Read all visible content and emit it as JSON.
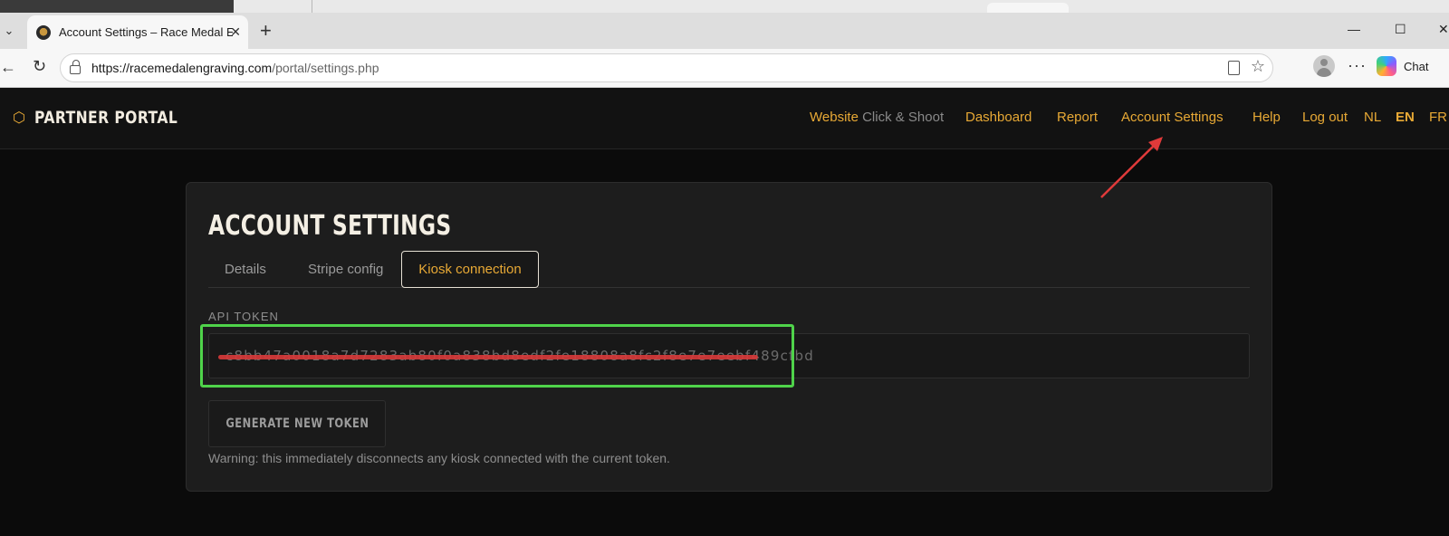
{
  "browser": {
    "tab_title": "Account Settings – Race Medal Engraving",
    "close_glyph": "✕",
    "newtab_glyph": "+",
    "url_host": "https://racemedalengraving.com",
    "url_path": "/portal/settings.php",
    "chat_label": "Chat",
    "win_min": "—",
    "win_max": "☐",
    "win_close": "✕"
  },
  "header": {
    "brand": "PARTNER PORTAL",
    "nav": {
      "website": "Website",
      "website_sub": "Click & Shoot",
      "dashboard": "Dashboard",
      "report": "Report",
      "account_settings": "Account Settings",
      "help": "Help",
      "logout": "Log out",
      "lang_nl": "NL",
      "lang_en": "EN",
      "lang_fr": "FR"
    }
  },
  "card": {
    "title": "ACCOUNT SETTINGS",
    "tabs": [
      "Details",
      "Stripe config",
      "Kiosk connection"
    ],
    "active_tab": "Kiosk connection",
    "api_label": "API TOKEN",
    "token_value": "c8bb47a0018a7d7283ab80f0a838bd8edf2fe18808a8fc2f8e7e7eebf489cfbd",
    "generate_button": "GENERATE NEW TOKEN",
    "warning": "Warning: this immediately disconnects any kiosk connected with the current token."
  },
  "colors": {
    "accent": "#e8a935",
    "highlight": "#4fd34a",
    "redaction": "#d63a3a",
    "arrow": "#e03a3a"
  }
}
